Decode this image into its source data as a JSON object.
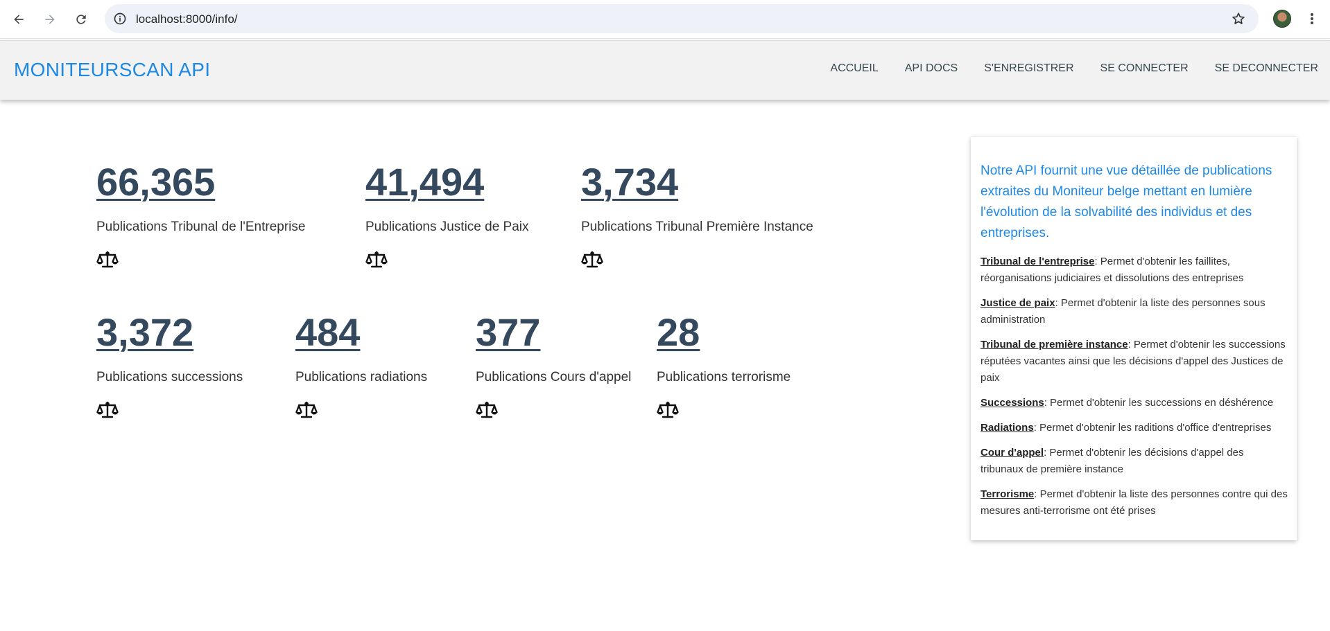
{
  "browser": {
    "url": "localhost:8000/info/"
  },
  "navbar": {
    "brand": "MONITEURSCAN API",
    "links": [
      "ACCUEIL",
      "API DOCS",
      "S'ENREGISTRER",
      "SE CONNECTER",
      "SE DECONNECTER"
    ]
  },
  "stats": [
    {
      "value": "66,365",
      "label": "Publications Tribunal de l'Entreprise",
      "icon": "scale-icon"
    },
    {
      "value": "41,494",
      "label": "Publications Justice de Paix",
      "icon": "scale-icon"
    },
    {
      "value": "3,734",
      "label": "Publications Tribunal Première Instance",
      "icon": "scale-icon"
    },
    {
      "value": "3,372",
      "label": "Publications successions",
      "icon": "scale-icon"
    },
    {
      "value": "484",
      "label": "Publications radiations",
      "icon": "scale-icon"
    },
    {
      "value": "377",
      "label": "Publications Cours d'appel",
      "icon": "scale-icon"
    },
    {
      "value": "28",
      "label": "Publications terrorisme",
      "icon": "scale-icon"
    }
  ],
  "info": {
    "intro": "Notre API fournit une vue détaillée de publications extraites du Moniteur belge mettant en lumière l'évolution de la solvabilité des individus et des entreprises.",
    "items": [
      {
        "term": "Tribunal de l'entreprise",
        "text": ": Permet d'obtenir les faillites, réorganisations judiciaires et dissolutions des entreprises"
      },
      {
        "term": "Justice de paix",
        "text": ": Permet d'obtenir la liste des personnes sous administration"
      },
      {
        "term": "Tribunal de première instance",
        "text": ": Permet d'obtenir les successions réputées vacantes ainsi que les décisions d'appel des Justices de paix"
      },
      {
        "term": "Successions",
        "text": ": Permet d'obtenir les successions en déshérence"
      },
      {
        "term": "Radiations",
        "text": ": Permet d'obtenir les raditions d'office d'entreprises"
      },
      {
        "term": "Cour d'appel",
        "text": ": Permet d'obtenir les décisions d'appel des tribunaux de première instance"
      },
      {
        "term": "Terrorisme",
        "text": ": Permet d'obtenir la liste des personnes contre qui des mesures anti-terrorisme ont été prises"
      }
    ]
  },
  "colors": {
    "brand": "#1e88e5",
    "stat_value": "#34495e"
  }
}
